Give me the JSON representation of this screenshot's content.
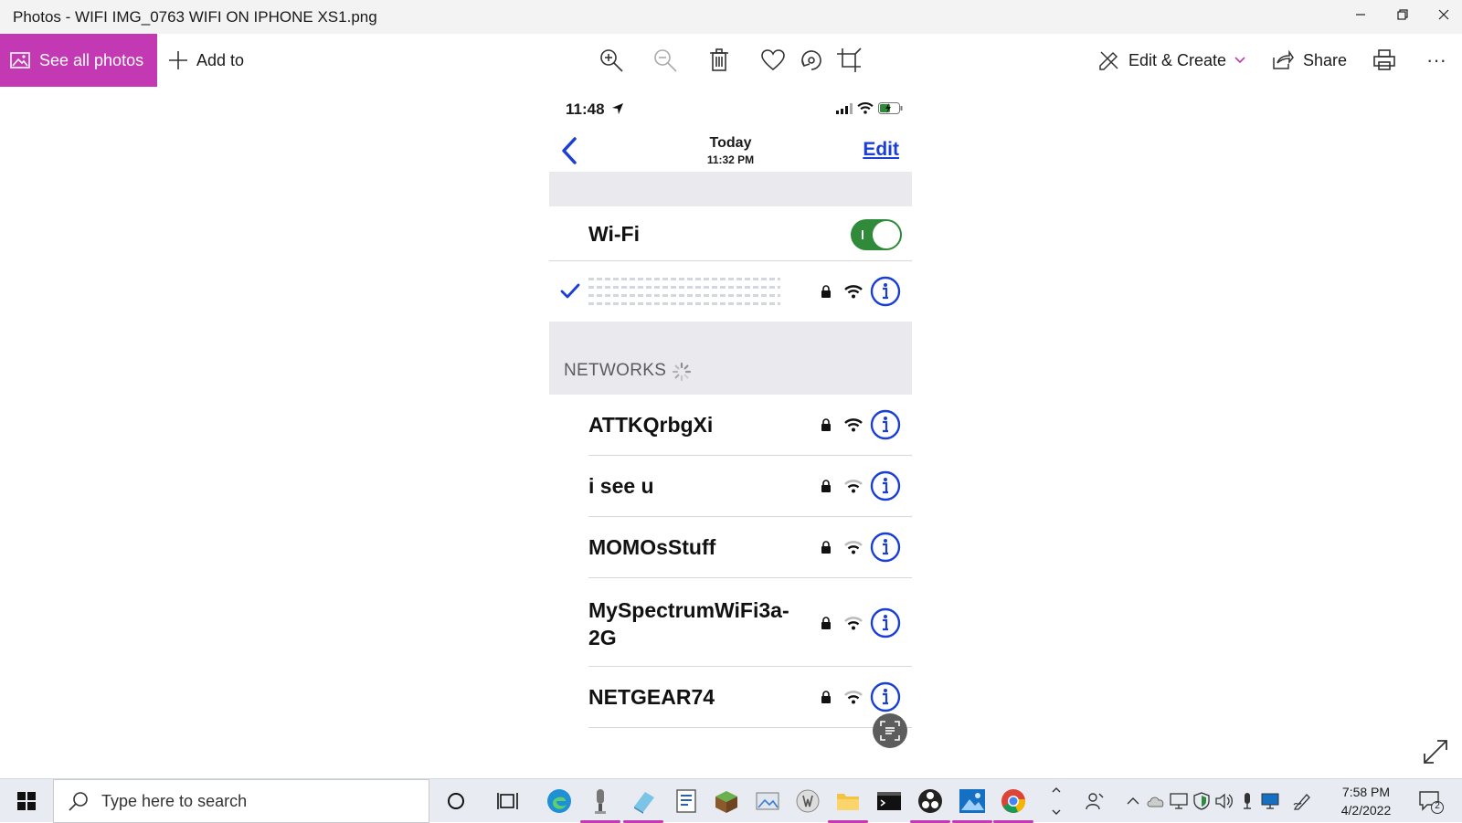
{
  "window": {
    "title": "Photos - WIFI IMG_0763 WIFI ON IPHONE XS1.png"
  },
  "toolbar": {
    "see_all_photos": "See all photos",
    "add_to": "Add to",
    "edit_create": "Edit & Create",
    "share": "Share",
    "more": "···",
    "accent_color": "#c239b3"
  },
  "phone": {
    "time": "11:48",
    "nav_title": "Today",
    "nav_subtitle": "11:32 PM",
    "edit": "Edit",
    "wifi_label": "Wi-Fi",
    "wifi_on": true,
    "networks_header": "NETWORKS",
    "networks": [
      {
        "name": "ATTKQrbgXi"
      },
      {
        "name": "i see u"
      },
      {
        "name": "MOMOsStuff"
      },
      {
        "name": "MySpectrumWiFi3a-2G"
      },
      {
        "name": "NETGEAR74"
      }
    ],
    "link_color": "#1a3fd6",
    "toggle_color": "#2f8a3a"
  },
  "taskbar": {
    "search_placeholder": "Type here to search",
    "time": "7:58 PM",
    "date": "4/2/2022",
    "notification_count": "2"
  }
}
